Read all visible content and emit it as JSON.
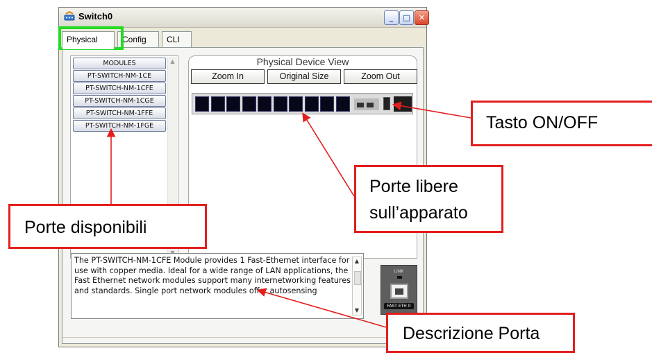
{
  "window": {
    "title": "Switch0",
    "controls": {
      "minimize": "_",
      "maximize": "□",
      "close": "✕"
    }
  },
  "tabs": [
    {
      "label": "Physical",
      "active": true
    },
    {
      "label": "Config",
      "active": false
    },
    {
      "label": "CLI",
      "active": false
    }
  ],
  "modules": {
    "header": "MODULES",
    "items": [
      "PT-SWITCH-NM-1CE",
      "PT-SWITCH-NM-1CFE",
      "PT-SWITCH-NM-1CGE",
      "PT-SWITCH-NM-1FFE",
      "PT-SWITCH-NM-1FGE"
    ]
  },
  "physical_view": {
    "title": "Physical Device View",
    "zoom_in": "Zoom In",
    "original_size": "Original Size",
    "zoom_out": "Zoom Out",
    "port_count": 10
  },
  "description": {
    "text": "The PT-SWITCH-NM-1CFE Module provides 1 Fast-Ethernet interface for use with copper media. Ideal for a wide range of LAN applications, the Fast Ethernet network modules support many internetworking features and standards. Single port network modules offer autosensing"
  },
  "module_image": {
    "top_label": "LINK",
    "bottom_label": "FAST ETH 0"
  },
  "annotations": {
    "power": "Tasto ON/OFF",
    "free_ports_line1": "Porte libere",
    "free_ports_line2": "sull’apparato",
    "available_ports": "Porte disponibili",
    "port_description": "Descrizione Porta"
  },
  "colors": {
    "annotation_border": "#e31e1e",
    "tab_highlight": "#22dd22",
    "port_fill": "#07071a"
  }
}
